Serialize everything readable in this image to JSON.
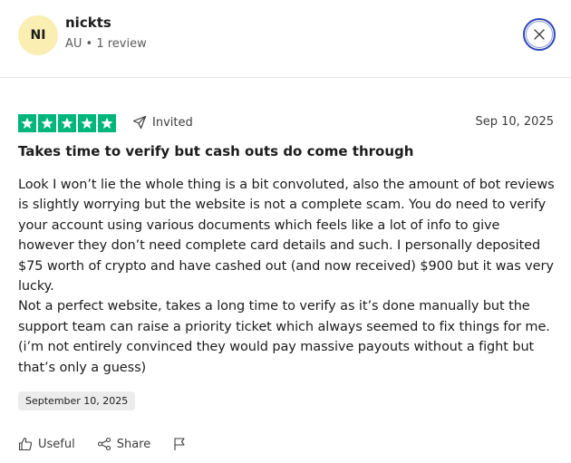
{
  "reviewer": {
    "initials": "NI",
    "name": "nickts",
    "meta": "AU • 1 review"
  },
  "review": {
    "rating": 5,
    "rating_color": "#00b67a",
    "invited_label": "Invited",
    "date": "Sep 10, 2025",
    "title": "Takes time to verify but cash outs do come through",
    "body_paragraphs": [
      "Look I won’t lie the whole thing is a bit convoluted, also the amount of bot reviews is slightly worrying but the website is not a complete scam. You do need to verify your account using various documents which feels like a lot of info to give however they don’t need complete card details and such. I personally deposited $75 worth of crypto and have cashed out (and now received) $900 but it was very lucky.",
      "Not a perfect website, takes a long time to verify as it’s done manually but the support team can raise a priority ticket which always seemed to fix things for me. (i’m not entirely convinced they would pay massive payouts without a fight but that’s only a guess)"
    ],
    "experience_date": "September 10, 2025"
  },
  "actions": {
    "useful_label": "Useful",
    "share_label": "Share"
  },
  "icons": {
    "close": "close-icon",
    "invited": "paper-plane-icon",
    "useful": "thumbs-up-icon",
    "share": "share-icon",
    "report": "flag-icon"
  },
  "colors": {
    "avatar_bg": "#fbeeb3",
    "close_ring": "#2c47b8",
    "star_box": "#00b67a"
  }
}
